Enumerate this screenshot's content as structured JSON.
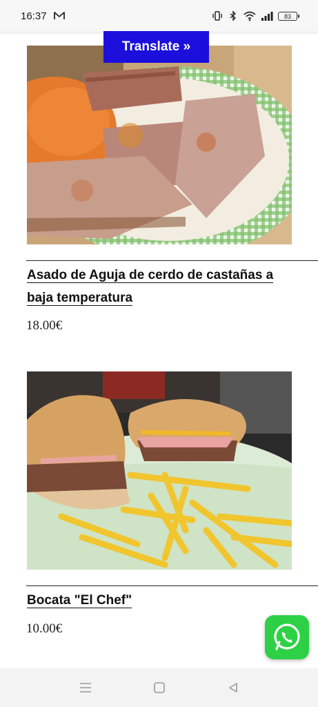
{
  "status_bar": {
    "time": "16:37",
    "battery": "83"
  },
  "translate": {
    "label": "Translate »"
  },
  "dishes": [
    {
      "name": "Asado de Aguja de cerdo de castañas a baja temperatura",
      "price": "18.00€"
    },
    {
      "name": "Bocata \"El Chef\"",
      "price": "10.00€"
    }
  ],
  "icons": {
    "mail": "gmail-icon",
    "vibrate": "vibrate-icon",
    "bluetooth": "bluetooth-icon",
    "wifi": "wifi-icon",
    "signal": "signal-icon",
    "battery": "battery-icon",
    "whatsapp": "whatsapp-icon",
    "menu": "menu-icon",
    "home": "home-icon",
    "back": "back-icon"
  },
  "colors": {
    "translate_bg": "#1c0fdc",
    "whatsapp_bg": "#2ed146"
  }
}
